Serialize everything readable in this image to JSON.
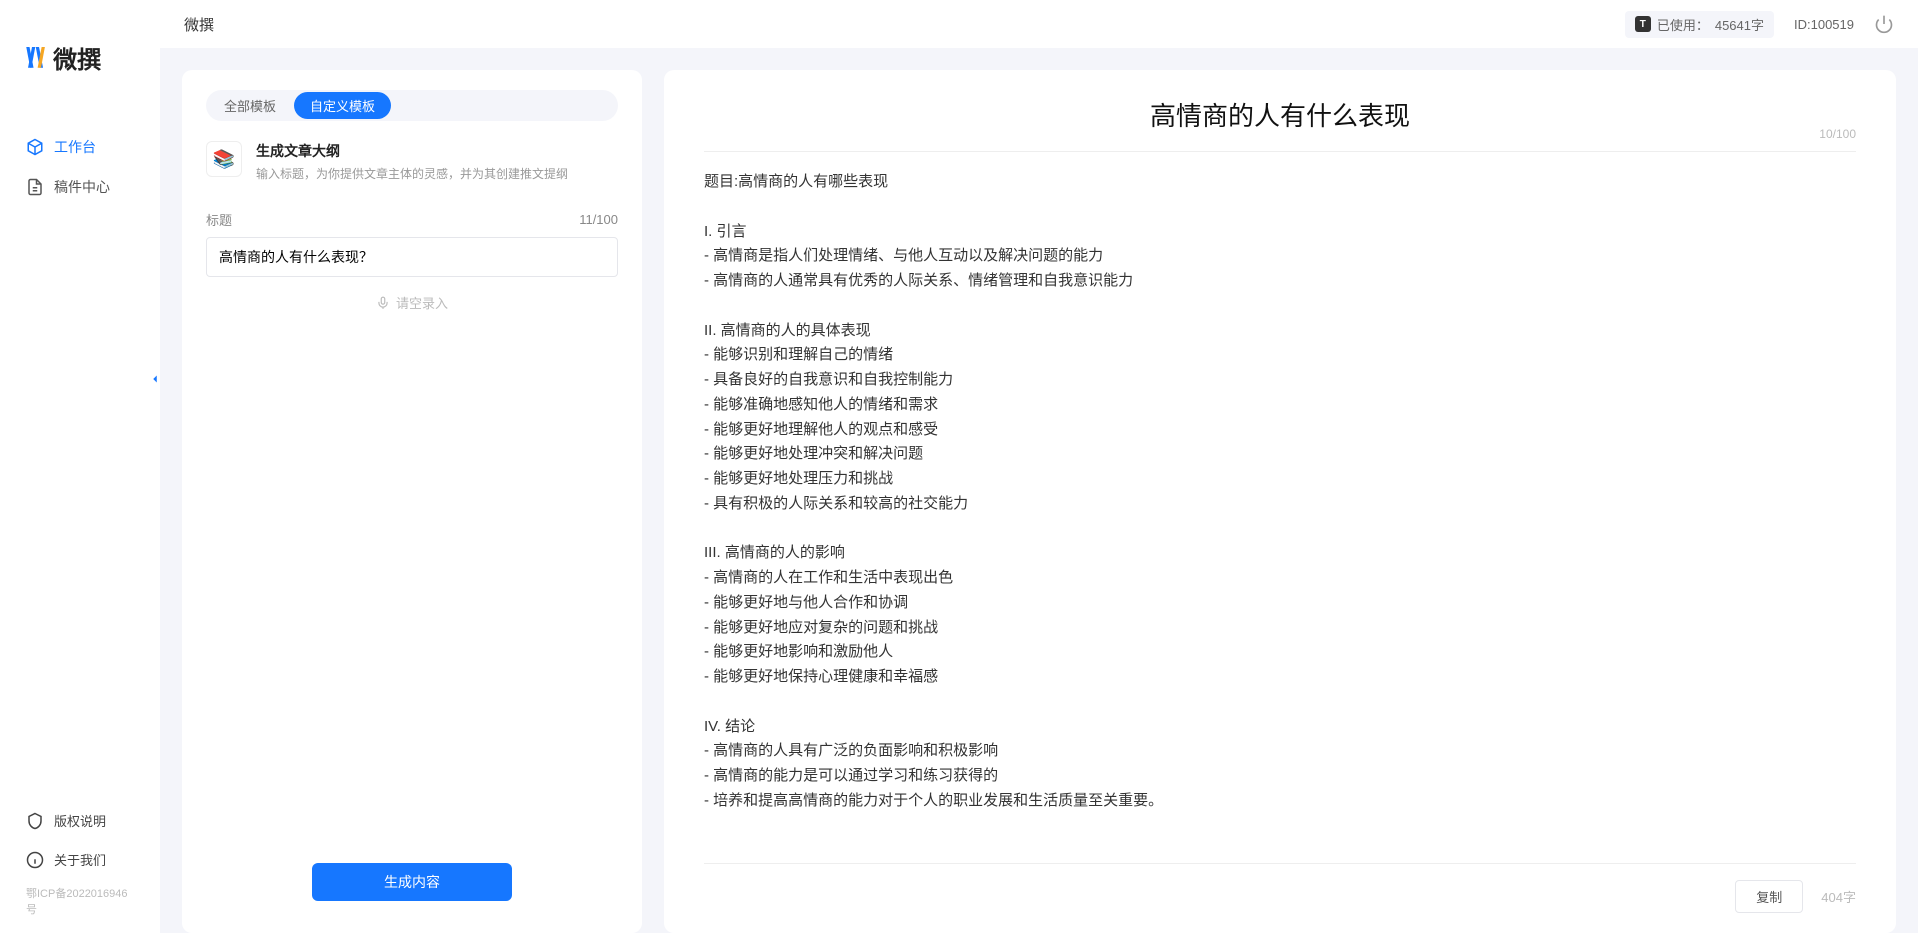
{
  "brand": {
    "name": "微撰"
  },
  "sidebar": {
    "items": [
      {
        "label": "工作台"
      },
      {
        "label": "稿件中心"
      }
    ],
    "bottom": [
      {
        "label": "版权说明"
      },
      {
        "label": "关于我们"
      }
    ],
    "icp": "鄂ICP备2022016946号"
  },
  "topbar": {
    "title": "微撰",
    "usage_label": "已使用：",
    "usage_value": "45641字",
    "id_label": "ID:100519"
  },
  "left": {
    "tabs": [
      {
        "label": "全部模板"
      },
      {
        "label": "自定义模板"
      }
    ],
    "template": {
      "name": "生成文章大纲",
      "desc": "输入标题，为你提供文章主体的灵感，并为其创建推文提纲"
    },
    "field_label": "标题",
    "char_count": "11/100",
    "input_value": "高情商的人有什么表现？",
    "voice_label": "请空录入",
    "generate_label": "生成内容"
  },
  "right": {
    "title": "高情商的人有什么表现",
    "title_count": "10/100",
    "body": "题目:高情商的人有哪些表现\n\nI. 引言\n- 高情商是指人们处理情绪、与他人互动以及解决问题的能力\n- 高情商的人通常具有优秀的人际关系、情绪管理和自我意识能力\n\nII. 高情商的人的具体表现\n- 能够识别和理解自己的情绪\n- 具备良好的自我意识和自我控制能力\n- 能够准确地感知他人的情绪和需求\n- 能够更好地理解他人的观点和感受\n- 能够更好地处理冲突和解决问题\n- 能够更好地处理压力和挑战\n- 具有积极的人际关系和较高的社交能力\n\nIII. 高情商的人的影响\n- 高情商的人在工作和生活中表现出色\n- 能够更好地与他人合作和协调\n- 能够更好地应对复杂的问题和挑战\n- 能够更好地影响和激励他人\n- 能够更好地保持心理健康和幸福感\n\nIV. 结论\n- 高情商的人具有广泛的负面影响和积极影响\n- 高情商的能力是可以通过学习和练习获得的\n- 培养和提高高情商的能力对于个人的职业发展和生活质量至关重要。",
    "copy_label": "复制",
    "word_count": "404字"
  }
}
